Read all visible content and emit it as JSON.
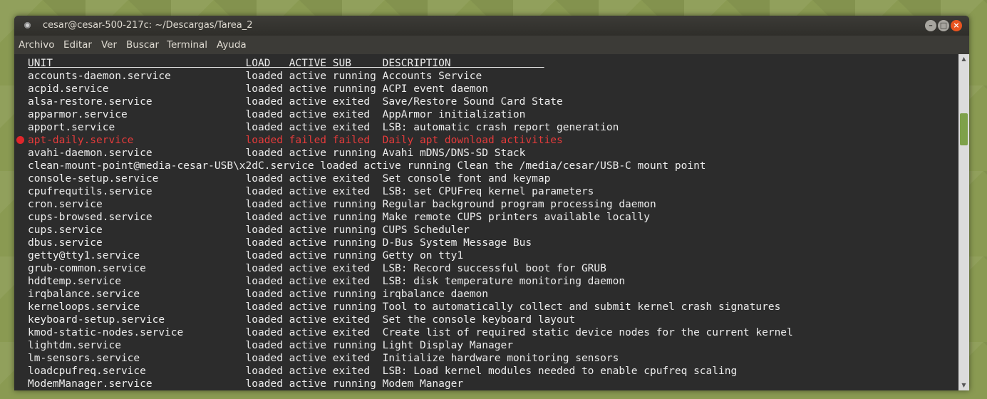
{
  "window": {
    "title": "cesar@cesar-500-217c: ~/Descargas/Tarea_2",
    "controls": {
      "minimize": "–",
      "maximize": "□",
      "close": "×"
    }
  },
  "menu": [
    "Archivo",
    "Editar",
    "Ver",
    "Buscar",
    "Terminal",
    "Ayuda"
  ],
  "terminal": {
    "header": "UNIT                               LOAD   ACTIVE SUB     DESCRIPTION               ",
    "rows": [
      "accounts-daemon.service            loaded active running Accounts Service",
      "acpid.service                      loaded active running ACPI event daemon",
      "alsa-restore.service               loaded active exited  Save/Restore Sound Card State",
      "apparmor.service                   loaded active exited  AppArmor initialization",
      "apport.service                     loaded active exited  LSB: automatic crash report generation",
      "apt-daily.service                  loaded failed failed  Daily apt download activities",
      "avahi-daemon.service               loaded active running Avahi mDNS/DNS-SD Stack",
      "clean-mount-point@media-cesar-USB\\x2dC.service loaded active running Clean the /media/cesar/USB-C mount point",
      "console-setup.service              loaded active exited  Set console font and keymap",
      "cpufrequtils.service               loaded active exited  LSB: set CPUFreq kernel parameters",
      "cron.service                       loaded active running Regular background program processing daemon",
      "cups-browsed.service               loaded active running Make remote CUPS printers available locally",
      "cups.service                       loaded active running CUPS Scheduler",
      "dbus.service                       loaded active running D-Bus System Message Bus",
      "getty@tty1.service                 loaded active running Getty on tty1",
      "grub-common.service                loaded active exited  LSB: Record successful boot for GRUB",
      "hddtemp.service                    loaded active exited  LSB: disk temperature monitoring daemon",
      "irqbalance.service                 loaded active running irqbalance daemon",
      "kerneloops.service                 loaded active running Tool to automatically collect and submit kernel crash signatures",
      "keyboard-setup.service             loaded active exited  Set the console keyboard layout",
      "kmod-static-nodes.service          loaded active exited  Create list of required static device nodes for the current kernel",
      "lightdm.service                    loaded active running Light Display Manager",
      "lm-sensors.service                 loaded active exited  Initialize hardware monitoring sensors",
      "loadcpufreq.service                loaded active exited  LSB: Load kernel modules needed to enable cpufreq scaling",
      "ModemManager.service               loaded active running Modem Manager"
    ],
    "failed_row_index": 5
  },
  "colors": {
    "failed": "#e53b3b",
    "failed_dot": "#e0262b",
    "scroll_thumb": "#7ea14a"
  },
  "scrollbar": {
    "up_icon": "▲",
    "down_icon": "▼"
  }
}
